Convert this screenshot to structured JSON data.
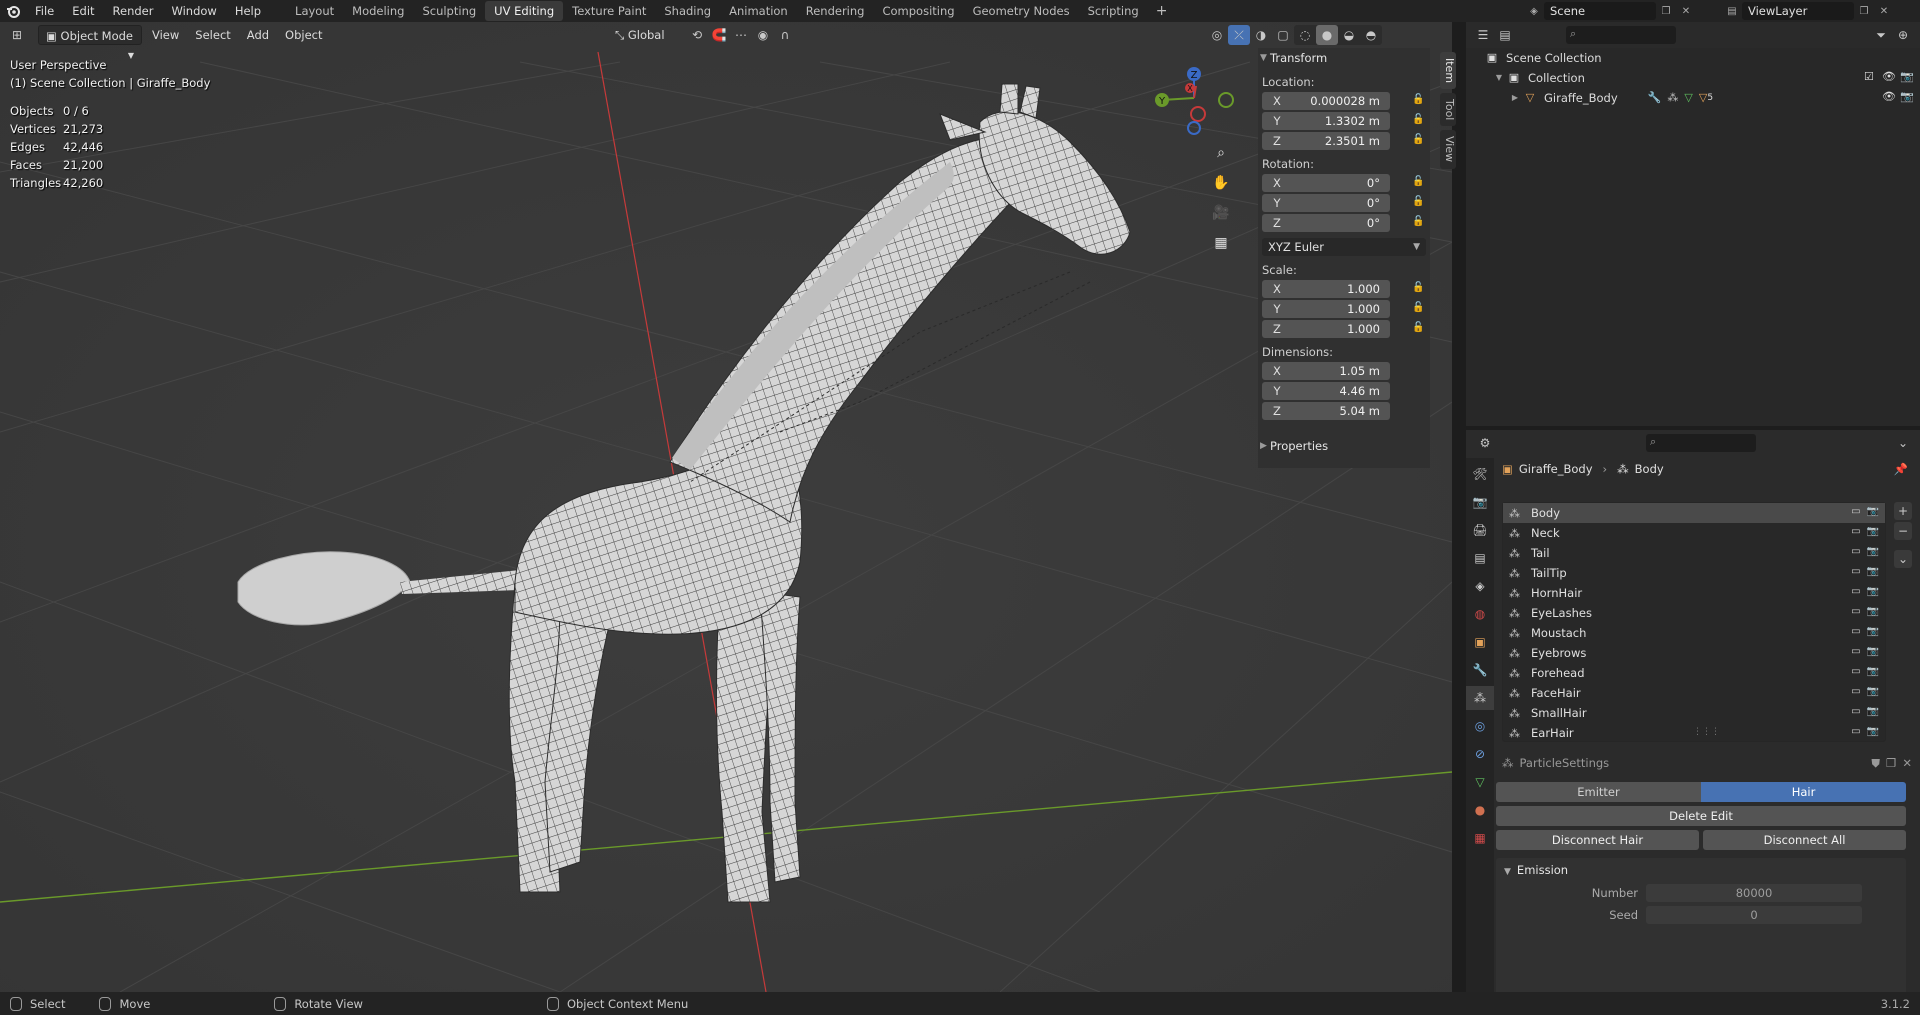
{
  "app": {
    "version": "3.1.2"
  },
  "menus": [
    "File",
    "Edit",
    "Render",
    "Window",
    "Help"
  ],
  "workspaces": {
    "tabs": [
      "Layout",
      "Modeling",
      "Sculpting",
      "UV Editing",
      "Texture Paint",
      "Shading",
      "Animation",
      "Rendering",
      "Compositing",
      "Geometry Nodes",
      "Scripting"
    ],
    "active": "UV Editing"
  },
  "scene": {
    "name": "Scene",
    "view_layer": "ViewLayer"
  },
  "viewport": {
    "mode": "Object Mode",
    "menus": [
      "View",
      "Select",
      "Add",
      "Object"
    ],
    "orientation": "Global",
    "view_name": "User Perspective",
    "collection_line": "(1) Scene Collection | Giraffe_Body",
    "stats": [
      {
        "label": "Objects",
        "value": "0 / 6"
      },
      {
        "label": "Vertices",
        "value": "21,273"
      },
      {
        "label": "Edges",
        "value": "42,446"
      },
      {
        "label": "Faces",
        "value": "21,200"
      },
      {
        "label": "Triangles",
        "value": "42,260"
      }
    ],
    "gizmo": {
      "z": "Z",
      "y": "Y",
      "x": "X"
    }
  },
  "npanel": {
    "tabs": [
      "Item",
      "Tool",
      "View"
    ],
    "transform_title": "Transform",
    "location_label": "Location:",
    "location": [
      {
        "axis": "X",
        "value": "0.000028 m"
      },
      {
        "axis": "Y",
        "value": "1.3302 m"
      },
      {
        "axis": "Z",
        "value": "2.3501 m"
      }
    ],
    "rotation_label": "Rotation:",
    "rotation": [
      {
        "axis": "X",
        "value": "0°"
      },
      {
        "axis": "Y",
        "value": "0°"
      },
      {
        "axis": "Z",
        "value": "0°"
      }
    ],
    "rotation_mode": "XYZ Euler",
    "scale_label": "Scale:",
    "scale": [
      {
        "axis": "X",
        "value": "1.000"
      },
      {
        "axis": "Y",
        "value": "1.000"
      },
      {
        "axis": "Z",
        "value": "1.000"
      }
    ],
    "dimensions_label": "Dimensions:",
    "dimensions": [
      {
        "axis": "X",
        "value": "1.05 m"
      },
      {
        "axis": "Y",
        "value": "4.46 m"
      },
      {
        "axis": "Z",
        "value": "5.04 m"
      }
    ],
    "properties_title": "Properties"
  },
  "outliner": {
    "root": "Scene Collection",
    "collection": "Collection",
    "object": "Giraffe_Body",
    "modifier_count": "5"
  },
  "properties": {
    "breadcrumb_object": "Giraffe_Body",
    "breadcrumb_system": "Body",
    "particle_systems": [
      "Body",
      "Neck",
      "Tail",
      "TailTip",
      "HornHair",
      "EyeLashes",
      "Moustach",
      "Eyebrows",
      "Forehead",
      "FaceHair",
      "SmallHair",
      "EarHair"
    ],
    "active_system": "Body",
    "settings_name": "ParticleSettings",
    "type_options": [
      "Emitter",
      "Hair"
    ],
    "type_active": "Hair",
    "delete_edit": "Delete Edit",
    "disconnect_hair": "Disconnect Hair",
    "disconnect_all": "Disconnect All",
    "emission_title": "Emission",
    "number_label": "Number",
    "number_value": "80000",
    "seed_label": "Seed",
    "seed_value": "0"
  },
  "statusbar": {
    "select": "Select",
    "move": "Move",
    "rotate": "Rotate View",
    "context": "Object Context Menu"
  },
  "colors": {
    "accent_blue": "#4772b3",
    "viewport_bg": "#3a3a3a",
    "axis_x": "#c63a3a",
    "axis_y": "#6a9a2a",
    "axis_z": "#3a6ac6"
  }
}
